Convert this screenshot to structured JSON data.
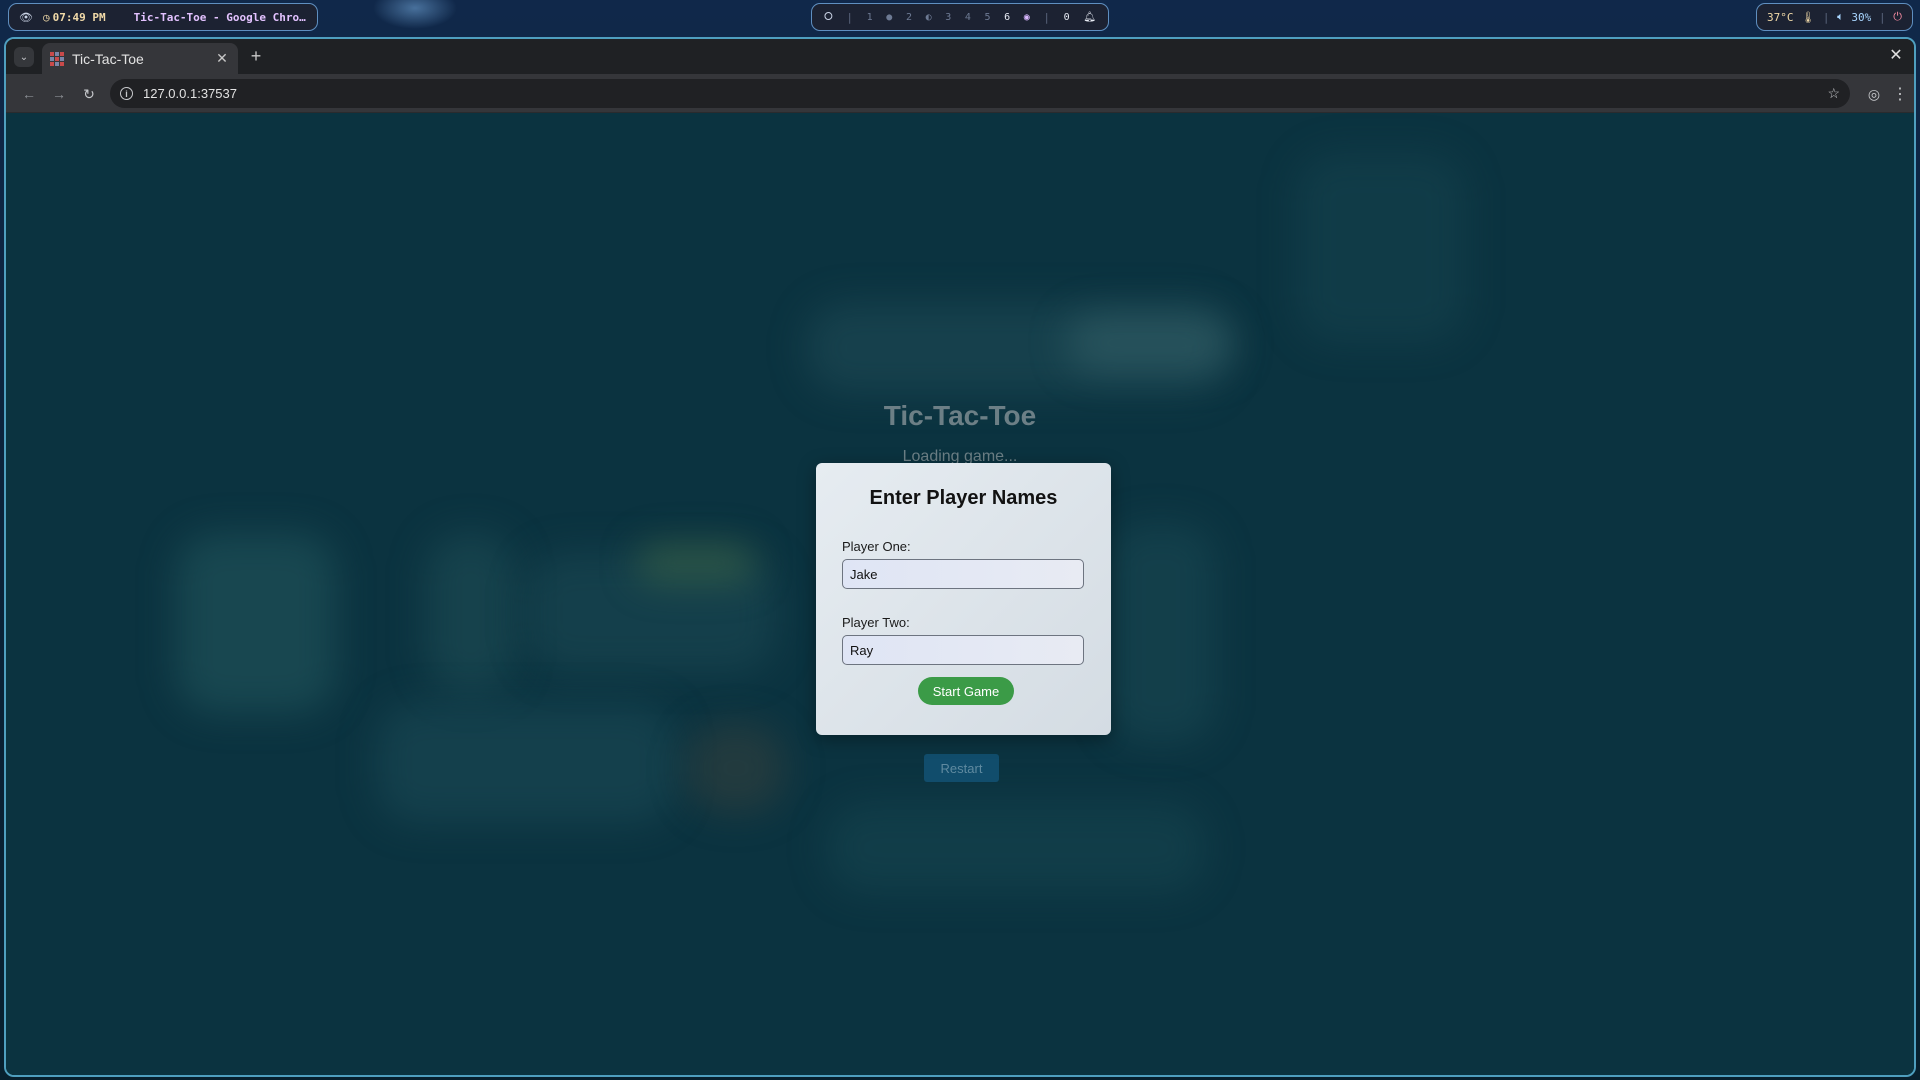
{
  "statusbar": {
    "left": {
      "eye_icon": "eye-slash-icon",
      "time": "07:49 PM",
      "window_title": "Tic-Tac-Toe - Google Chro…"
    },
    "center": {
      "workspaces": [
        "1",
        "2",
        "3",
        "4",
        "5",
        "6"
      ],
      "active_workspace": "6",
      "notifications": "0"
    },
    "right": {
      "temperature": "37°C",
      "volume": "30%"
    }
  },
  "browser": {
    "tab_title": "Tic-Tac-Toe",
    "url": "127.0.0.1:37537"
  },
  "page": {
    "title": "Tic-Tac-Toe",
    "status": "Loading game...",
    "restart_label": "Restart"
  },
  "modal": {
    "title": "Enter Player Names",
    "player_one_label": "Player One:",
    "player_one_value": "Jake",
    "player_two_label": "Player Two:",
    "player_two_value": "Ray",
    "start_label": "Start Game"
  },
  "colors": {
    "page_background": "#0b3340",
    "start_button": "#3b9b47",
    "restart_button": "#114d6c",
    "window_border": "#4f9fbf"
  }
}
